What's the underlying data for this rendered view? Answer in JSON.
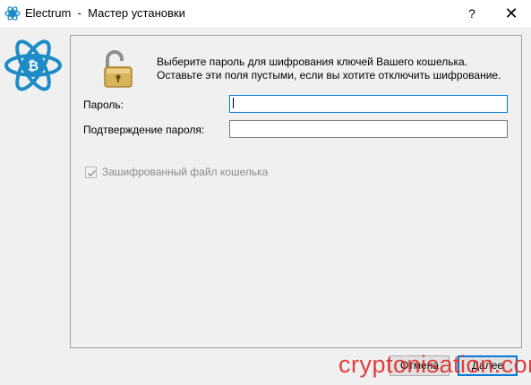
{
  "window": {
    "app_name": "Electrum",
    "separator": "-",
    "title": "Мастер установки",
    "help_label": "?",
    "close_label": "✕"
  },
  "icons": {
    "app": "electrum-bitcoin-atom-icon",
    "lock": "open-padlock-icon"
  },
  "colors": {
    "electrum_blue": "#1d8cc6",
    "focus_blue": "#0078d7",
    "watermark_red": "#e03030"
  },
  "panel": {
    "info_line1": "Выберите пароль для шифрования ключей Вашего кошелька.",
    "info_line2": "Оставьте эти поля пустыми, если вы хотите отключить шифрование.",
    "password_label": "Пароль:",
    "password_value": "",
    "confirm_label": "Подтверждение пароля:",
    "confirm_value": "",
    "encrypt_checkbox_label": "Зашифрованный файл кошелька",
    "encrypt_checked": true,
    "encrypt_enabled": false
  },
  "buttons": {
    "cancel_label": "Отмена",
    "next_label": "Далее"
  },
  "watermark": {
    "text": "cryptonisation.com"
  }
}
